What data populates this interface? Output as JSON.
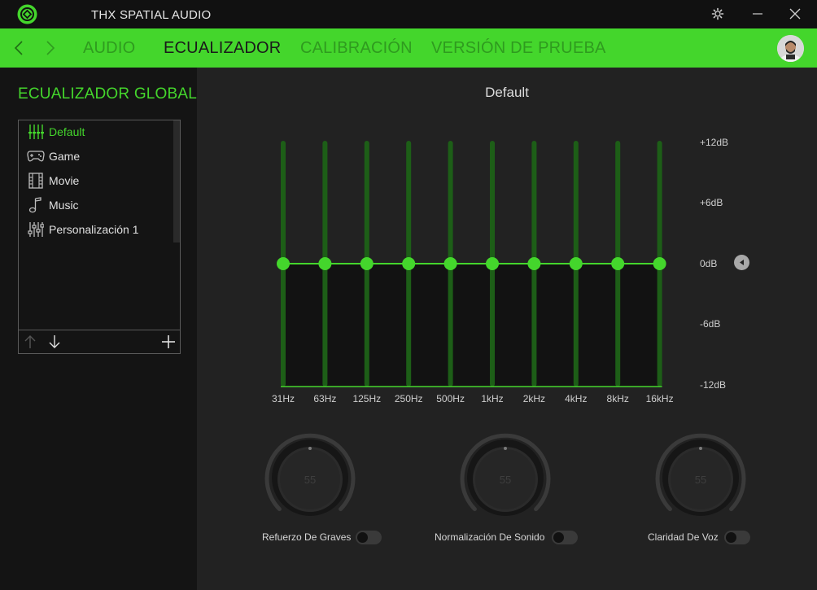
{
  "window": {
    "title": "THX SPATIAL AUDIO",
    "controls": [
      "gear-icon",
      "minimize-icon",
      "close-icon"
    ]
  },
  "nav": {
    "tabs": [
      {
        "label": "AUDIO",
        "active": false
      },
      {
        "label": "ECUALIZADOR",
        "active": true
      },
      {
        "label": "CALIBRACIÓN",
        "active": false
      },
      {
        "label": "VERSIÓN DE PRUEBA",
        "active": false
      }
    ],
    "accent": "#44d62c"
  },
  "sidebar": {
    "title": "ECUALIZADOR GLOBAL",
    "presets": [
      {
        "label": "Default",
        "icon": "equalizer-icon",
        "active": true
      },
      {
        "label": "Game",
        "icon": "gamepad-icon",
        "active": false
      },
      {
        "label": "Movie",
        "icon": "film-icon",
        "active": false
      },
      {
        "label": "Music",
        "icon": "music-note-icon",
        "active": false
      },
      {
        "label": "Personalización 1",
        "icon": "sliders-icon",
        "active": false
      }
    ],
    "toolbar": [
      "arrow-up-icon",
      "arrow-down-icon",
      "plus-icon"
    ]
  },
  "equalizer": {
    "preset_name": "Default",
    "db_labels": [
      "+12dB",
      "+6dB",
      "0dB",
      "-6dB",
      "-12dB"
    ],
    "db_range": [
      -12,
      12
    ],
    "bands": [
      {
        "label": "31Hz",
        "gain": 0
      },
      {
        "label": "63Hz",
        "gain": 0
      },
      {
        "label": "125Hz",
        "gain": 0
      },
      {
        "label": "250Hz",
        "gain": 0
      },
      {
        "label": "500Hz",
        "gain": 0
      },
      {
        "label": "1kHz",
        "gain": 0
      },
      {
        "label": "2kHz",
        "gain": 0
      },
      {
        "label": "4kHz",
        "gain": 0
      },
      {
        "label": "8kHz",
        "gain": 0
      },
      {
        "label": "16kHz",
        "gain": 0
      }
    ]
  },
  "enhancements": [
    {
      "label": "Refuerzo De Graves",
      "value": "55",
      "enabled": false
    },
    {
      "label": "Normalización De Sonido",
      "value": "55",
      "enabled": false
    },
    {
      "label": "Claridad De Voz",
      "value": "55",
      "enabled": false
    }
  ]
}
